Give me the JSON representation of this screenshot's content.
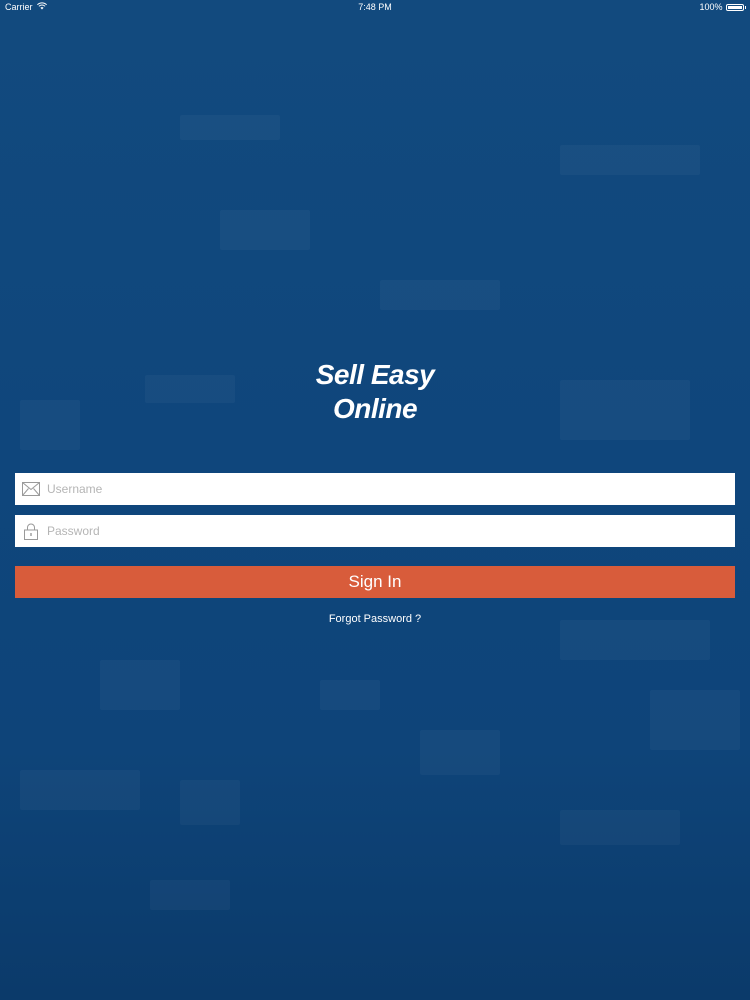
{
  "status_bar": {
    "carrier": "Carrier",
    "time": "7:48 PM",
    "battery": "100%"
  },
  "app": {
    "title_line1": "Sell Easy",
    "title_line2": "Online"
  },
  "login": {
    "username_placeholder": "Username",
    "username_value": "",
    "password_placeholder": "Password",
    "password_value": "",
    "signin_label": "Sign In",
    "forgot_label": "Forgot Password ?"
  },
  "colors": {
    "background": "#124a7e",
    "signin_button": "#d85c3b",
    "text": "#ffffff"
  },
  "icons": {
    "username": "envelope-icon",
    "password": "lock-icon",
    "wifi": "wifi-icon",
    "battery": "battery-icon"
  }
}
